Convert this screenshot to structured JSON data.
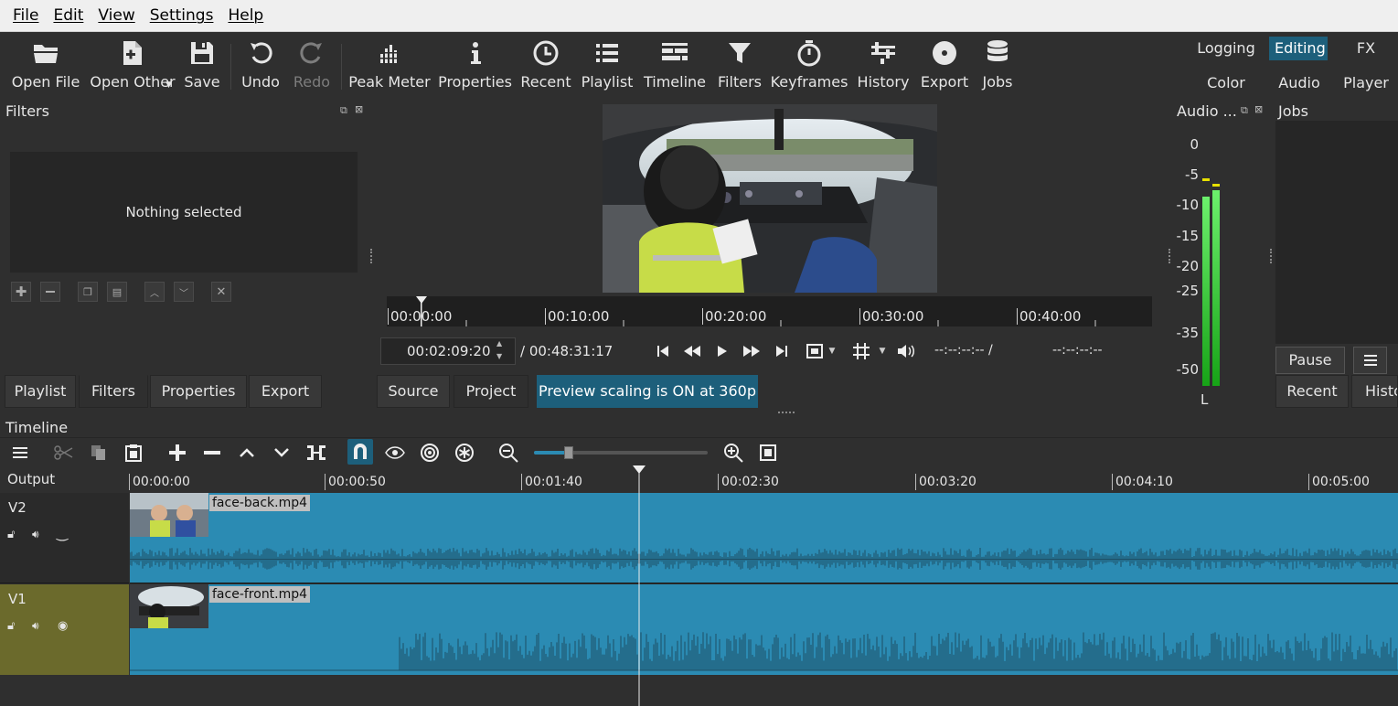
{
  "menu": [
    "File",
    "Edit",
    "View",
    "Settings",
    "Help"
  ],
  "toolbar": {
    "open_file": "Open File",
    "open_other": "Open Other",
    "save": "Save",
    "undo": "Undo",
    "redo": "Redo",
    "peak_meter": "Peak Meter",
    "properties": "Properties",
    "recent": "Recent",
    "playlist": "Playlist",
    "timeline": "Timeline",
    "filters": "Filters",
    "keyframes": "Keyframes",
    "history": "History",
    "export": "Export",
    "jobs": "Jobs"
  },
  "layouts": {
    "logging": "Logging",
    "editing": "Editing",
    "fx": "FX",
    "color": "Color",
    "audio": "Audio",
    "player": "Player"
  },
  "filters_panel": {
    "title": "Filters",
    "empty_text": "Nothing selected"
  },
  "left_tabs": [
    "Playlist",
    "Filters",
    "Properties",
    "Export"
  ],
  "player": {
    "ruler": [
      "00:00:00",
      "00:10:00",
      "00:20:00",
      "00:30:00",
      "00:40:00"
    ],
    "position": "00:02:09:20",
    "duration": "/ 00:48:31:17",
    "in_point": "--:--:--:-- /",
    "out_point": "--:--:--:--",
    "tabs": [
      "Source",
      "Project"
    ],
    "scaling_notice": "Preview scaling is ON at 360p"
  },
  "audio_meter": {
    "title": "Audio ...",
    "scale": [
      "0",
      "-5",
      "-10",
      "-15",
      "-20",
      "-25",
      "-35",
      "-50"
    ],
    "channel": "L",
    "level_db": -8,
    "peak_db": -6
  },
  "jobs_panel": {
    "title": "Jobs",
    "pause": "Pause",
    "tabs": [
      "Recent",
      "Histo"
    ]
  },
  "timeline": {
    "title": "Timeline",
    "output_label": "Output",
    "ruler": [
      "00:00:00",
      "00:00:50",
      "00:01:40",
      "00:02:30",
      "00:03:20",
      "00:04:10",
      "00:05:00"
    ],
    "tracks": [
      {
        "name": "V2",
        "clip": "face-back.mp4"
      },
      {
        "name": "V1",
        "clip": "face-front.mp4"
      }
    ],
    "zoom_level": 0.2
  },
  "colors": {
    "accent": "#1d5f7b",
    "clip": "#2b8bb3",
    "selected_track": "#6b6a2c",
    "meter_green": "#2fd02f"
  }
}
